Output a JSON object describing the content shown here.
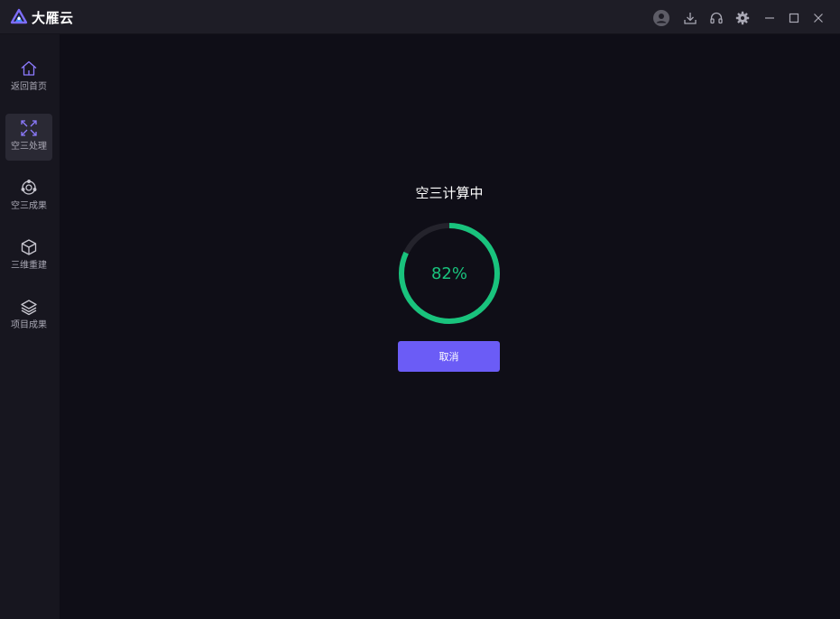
{
  "app": {
    "name": "大雁云",
    "brand_color": "#6b5cf6"
  },
  "titlebar": {
    "icons": [
      "user-avatar-icon",
      "download-icon",
      "headset-icon",
      "settings-gear-icon",
      "minimize-icon",
      "maximize-icon",
      "close-icon"
    ]
  },
  "sidebar": {
    "items": [
      {
        "label": "返回首页",
        "icon": "home-icon",
        "active": false
      },
      {
        "label": "空三处理",
        "icon": "aerotriangulation-icon",
        "active": true
      },
      {
        "label": "空三成果",
        "icon": "aero-result-icon",
        "active": false
      },
      {
        "label": "三维重建",
        "icon": "cube-icon",
        "active": false
      },
      {
        "label": "项目成果",
        "icon": "layers-icon",
        "active": false
      }
    ]
  },
  "main": {
    "title": "空三计算中",
    "progress_percent": 82,
    "progress_label": "82%",
    "progress_color": "#19c37d",
    "cancel_label": "取消"
  }
}
